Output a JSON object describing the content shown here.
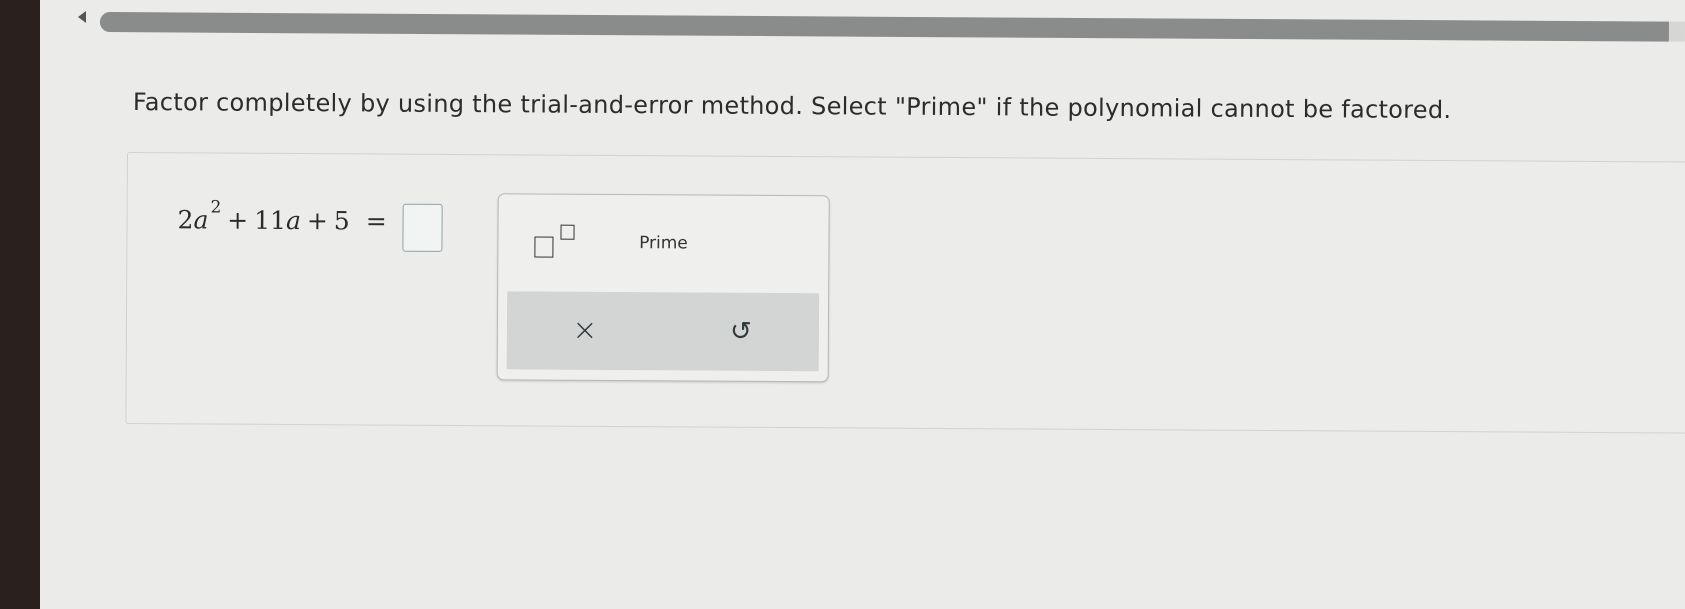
{
  "header": {
    "back_icon": "chevron-left-icon",
    "progress": 0.99
  },
  "question": {
    "instruction": "Factor completely by using the trial-and-error method. Select \"Prime\" if the polynomial cannot be factored.",
    "expression": {
      "coef1": "2",
      "var1": "a",
      "exp1": "2",
      "plus1": "+",
      "coef2": "11",
      "var2": "a",
      "plus2": "+",
      "const": "5",
      "equals": "="
    },
    "answer_value": ""
  },
  "palette": {
    "superscript_icon": "superscript-template-icon",
    "prime_label": "Prime",
    "clear_icon": "×",
    "undo_icon": "↺"
  },
  "colors": {
    "progress_fill": "#8a8b8b",
    "palette_bar": "#d3d4d4",
    "input_border": "#8fa3a3"
  }
}
